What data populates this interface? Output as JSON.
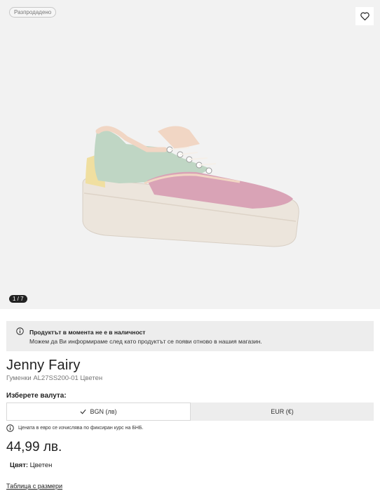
{
  "gallery": {
    "badge": "Разпродадено",
    "counter": "1 / 7",
    "icons": {
      "favorite": "heart-outline-icon"
    }
  },
  "notice": {
    "title": "Продуктът в момента не е в наличност",
    "text": "Можем да Ви информираме след като продуктът се появи отново в нашия магазин.",
    "icon": "info-icon"
  },
  "product": {
    "brand": "Jenny Fairy",
    "subtitle": "Гуменки AL27SS200-01 Цветен",
    "price": "44,99 лв.",
    "color_label": "Цвят:",
    "color_value": "Цветен",
    "size_table_link": "Таблица с размери"
  },
  "currency": {
    "label": "Изберете валута:",
    "options": [
      {
        "label": "BGN (лв)",
        "selected": true
      },
      {
        "label": "EUR (€)",
        "selected": false
      }
    ],
    "note": "Цената в евро се изчислява по фиксиран курс на БНБ."
  },
  "colors": {
    "hero_bg": "#f2f2f2",
    "notice_bg": "#ededed",
    "text": "#222222"
  }
}
